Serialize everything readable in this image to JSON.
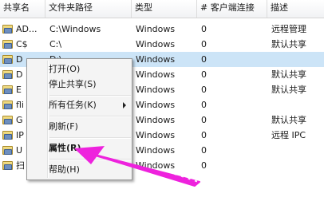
{
  "columns": [
    "共享名",
    "文件夹路径",
    "类型",
    "# 客户端连接",
    "描述"
  ],
  "rows": [
    {
      "name": "AD...",
      "path": "C:\\Windows",
      "type": "Windows",
      "clients": "0",
      "desc": "远程管理",
      "selected": false
    },
    {
      "name": "C$",
      "path": "C:\\",
      "type": "Windows",
      "clients": "0",
      "desc": "默认共享",
      "selected": false
    },
    {
      "name": "D",
      "path": "D:\\",
      "type": "Windows",
      "clients": "0",
      "desc": "",
      "selected": true
    },
    {
      "name": "D",
      "path": "",
      "type": "Windows",
      "clients": "0",
      "desc": "默认共享",
      "selected": false
    },
    {
      "name": "E",
      "path": "",
      "type": "Windows",
      "clients": "0",
      "desc": "默认共享",
      "selected": false
    },
    {
      "name": "fli",
      "path": "",
      "type": "Windows",
      "clients": "0",
      "desc": "",
      "selected": false
    },
    {
      "name": "G",
      "path": "",
      "type": "Windows",
      "clients": "0",
      "desc": "默认共享",
      "selected": false
    },
    {
      "name": "IP",
      "path": "",
      "type": "Windows",
      "clients": "0",
      "desc": "远程 IPC",
      "selected": false
    },
    {
      "name": "U",
      "path": "",
      "type": "Windows",
      "clients": "0",
      "desc": "",
      "selected": false
    },
    {
      "name": "扫",
      "path": "",
      "type": "Windows",
      "clients": "0",
      "desc": "",
      "selected": false
    }
  ],
  "context_menu": {
    "open": "打开(O)",
    "stop_sharing": "停止共享(S)",
    "all_tasks": "所有任务(K)",
    "refresh": "刷新(F)",
    "properties": "属性(R)",
    "help": "帮助(H)"
  },
  "colors": {
    "selection": "#cce4f7",
    "annotation_arrow": "#ee22dd"
  },
  "icons": {
    "share": "shared-folder-icon",
    "submenu": "chevron-right-icon"
  }
}
